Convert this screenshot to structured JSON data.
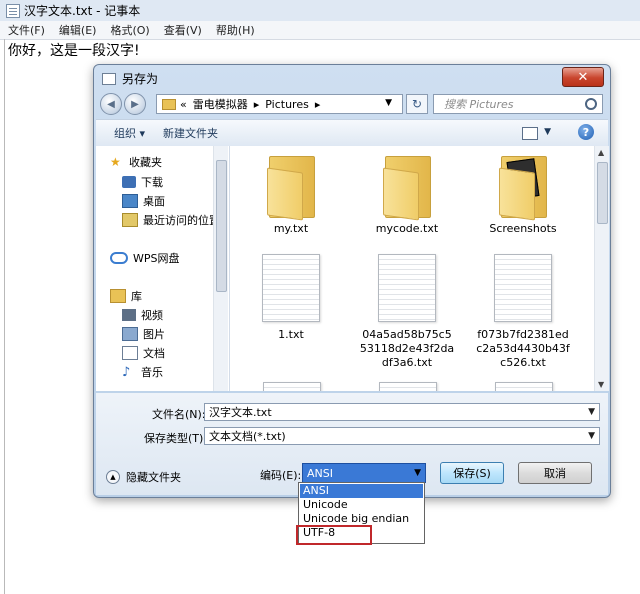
{
  "notepad": {
    "title": "汉字文本.txt - 记事本",
    "menu": [
      "文件(F)",
      "编辑(E)",
      "格式(O)",
      "查看(V)",
      "帮助(H)"
    ],
    "content": "你好，这是一段汉字!"
  },
  "dialog": {
    "title": "另存为",
    "close_glyph": "✕",
    "breadcrumb": [
      "«",
      "雷电模拟器",
      "▸",
      "Pictures",
      "▸"
    ],
    "search_placeholder": "搜索 Pictures",
    "toolbar": {
      "organize": "组织 ▾",
      "new_folder": "新建文件夹",
      "help": "?"
    },
    "nav": {
      "favorites": "收藏夹",
      "downloads": "下载",
      "desktop": "桌面",
      "recent": "最近访问的位置",
      "wps": "WPS网盘",
      "library": "库",
      "videos": "视频",
      "pictures": "图片",
      "documents": "文档",
      "music": "音乐"
    },
    "files": [
      {
        "name": "my.txt",
        "kind": "folder"
      },
      {
        "name": "mycode.txt",
        "kind": "folder"
      },
      {
        "name": "Screenshots",
        "kind": "folder-photo"
      },
      {
        "name": "1.txt",
        "kind": "document"
      },
      {
        "name": "04a5ad58b75c553118d2e43f2dadf3a6.txt",
        "kind": "document"
      },
      {
        "name": "f073b7fd2381edc2a53d4430b43fc526.txt",
        "kind": "document"
      }
    ],
    "filename_label": "文件名(N):",
    "filename_value": "汉字文本.txt",
    "savetype_label": "保存类型(T):",
    "savetype_value": "文本文档(*.txt)",
    "encoding_label": "编码(E):",
    "encoding_value": "ANSI",
    "save_button": "保存(S)",
    "cancel_button": "取消",
    "hide_folders": "隐藏文件夹",
    "encoding_options": [
      "ANSI",
      "Unicode",
      "Unicode big endian",
      "UTF-8"
    ],
    "highlight_color": "#c0282b",
    "selection_color": "#3a79d6"
  }
}
